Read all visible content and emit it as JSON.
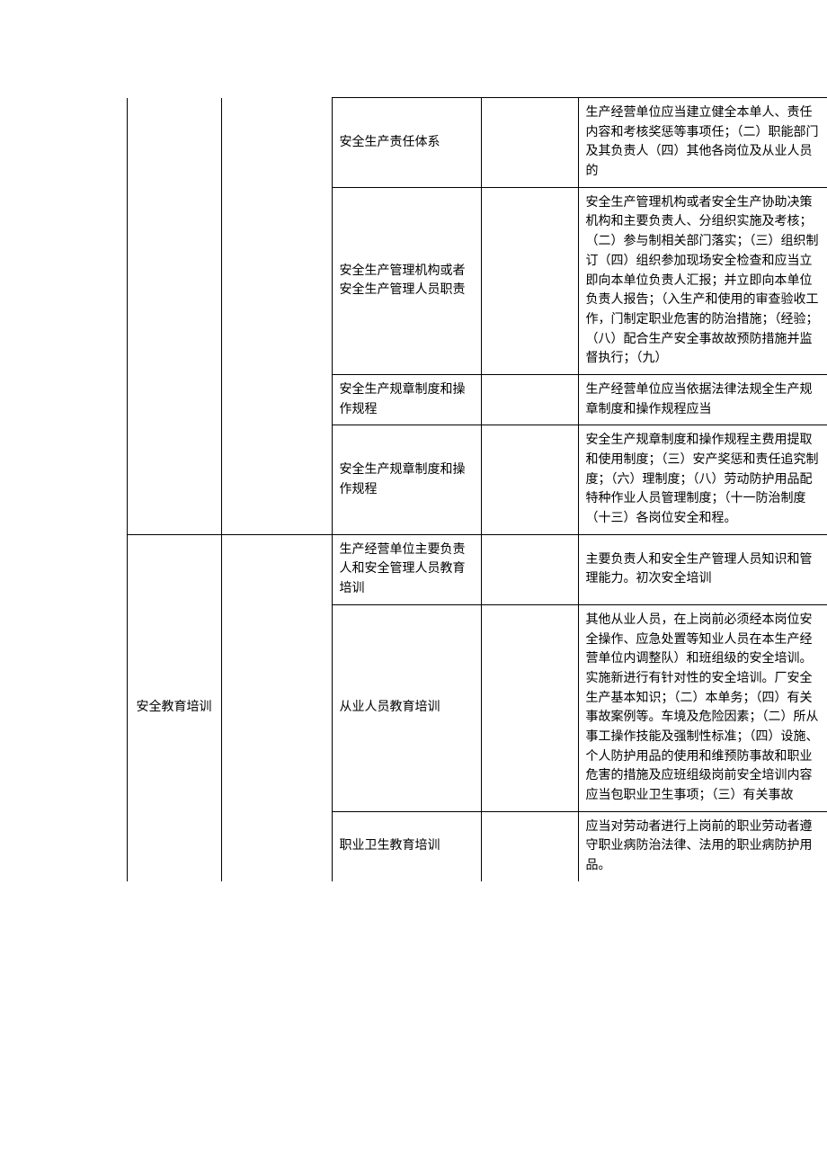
{
  "table": {
    "section_a_col2": "",
    "section_b_col2": "安全教育培训",
    "rows": [
      {
        "col3": "安全生产责任体系",
        "col5": "生产经营单位应当建立健全本单人、责任内容和考核奖惩等事项任；（二）职能部门及其负责人（四）其他各岗位及从业人员的"
      },
      {
        "col3": "安全生产管理机构或者安全生产管理人员职责",
        "col5": "安全生产管理机构或者安全生产协助决策机构和主要负责人、分组织实施及考核；（二）参与制相关部门落实；（三）组织制订（四）组织参加现场安全检查和应当立即向本单位负责人汇报；并立即向本单位负责人报告；（入生产和使用的审查验收工作，门制定职业危害的防治措施；（经验；（八）配合生产安全事故故预防措施并监督执行；（九）"
      },
      {
        "col3": "安全生产规章制度和操作规程",
        "col5": "生产经营单位应当依据法律法规全生产规章制度和操作规程应当"
      },
      {
        "col3": "安全生产规章制度和操作规程",
        "col5": "安全生产规章制度和操作规程主费用提取和使用制度；（三）安产奖惩和责任追究制度；（六）理制度；（八）劳动防护用品配特种作业人员管理制度；（十一防治制度（十三）各岗位安全和程。"
      },
      {
        "col3": "生产经营单位主要负责人和安全管理人员教育培训",
        "col5": "主要负责人和安全生产管理人员知识和管理能力。初次安全培训"
      },
      {
        "col3": "从业人员教育培训",
        "col5": "其他从业人员，在上岗前必须经本岗位安全操作、应急处置等知业人员在本生产经营单位内调整队）和班组级的安全培训。实施新进行有针对性的安全培训。厂安全生产基本知识；（二）本单务；（四）有关事故案例等。车境及危险因素；（二）所从事工操作技能及强制性标准；（四）设施、个人防护用品的使用和维预防事故和职业危害的措施及应班组级岗前安全培训内容应当包职业卫生事项；（三）有关事故"
      },
      {
        "col3": "职业卫生教育培训",
        "col5": "应当对劳动者进行上岗前的职业劳动者遵守职业病防治法律、法用的职业病防护用品。"
      }
    ]
  }
}
